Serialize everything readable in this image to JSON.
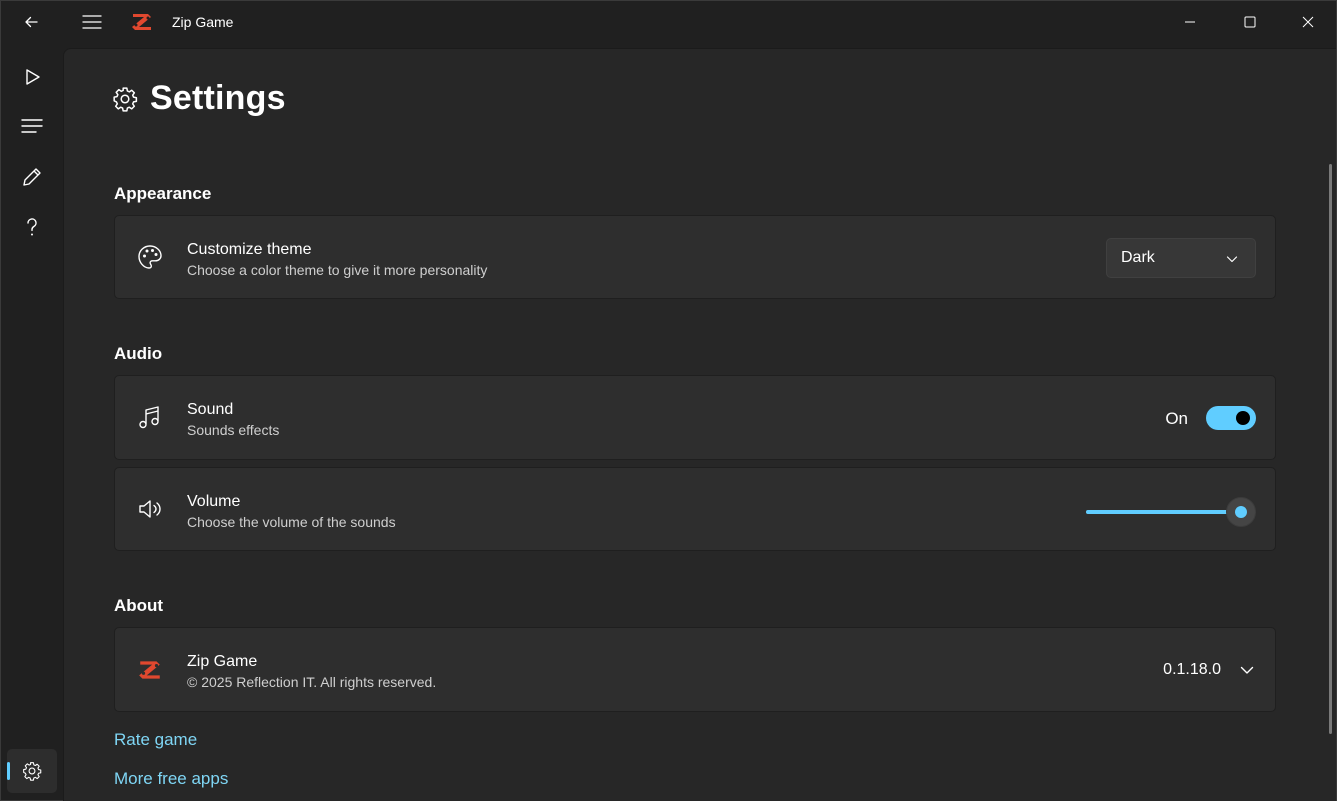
{
  "window": {
    "title": "Zip Game"
  },
  "page": {
    "title": "Settings"
  },
  "sections": {
    "appearance": {
      "title": "Appearance",
      "theme": {
        "title": "Customize theme",
        "subtitle": "Choose a color theme to give it more personality",
        "selected": "Dark"
      }
    },
    "audio": {
      "title": "Audio",
      "sound": {
        "title": "Sound",
        "subtitle": "Sounds effects",
        "state_label": "On",
        "enabled": true
      },
      "volume": {
        "title": "Volume",
        "subtitle": "Choose the volume of the sounds",
        "level_percent": 100
      }
    },
    "about": {
      "title": "About",
      "app": {
        "title": "Zip Game",
        "subtitle": "© 2025 Reflection IT. All rights reserved.",
        "version": "0.1.18.0"
      }
    }
  },
  "links": {
    "rate": "Rate game",
    "more_apps": "More free apps"
  },
  "nav": {
    "items": [
      "play-icon",
      "list-icon",
      "edit-icon",
      "help-icon"
    ],
    "active": "settings-icon"
  },
  "colors": {
    "accent": "#60cdff",
    "logo": "#e0482f",
    "link": "#7fd6f5"
  }
}
